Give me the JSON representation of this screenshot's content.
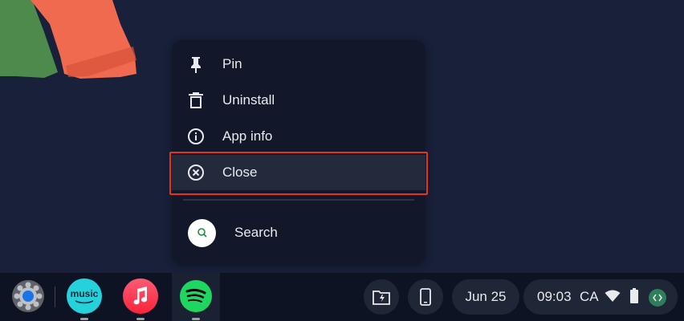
{
  "context_menu": {
    "items": [
      {
        "label": "Pin",
        "icon": "pin-icon"
      },
      {
        "label": "Uninstall",
        "icon": "trash-icon"
      },
      {
        "label": "App info",
        "icon": "info-icon"
      },
      {
        "label": "Close",
        "icon": "close-circle-icon",
        "highlighted": true
      }
    ],
    "search": {
      "label": "Search",
      "icon": "search-icon"
    }
  },
  "shelf": {
    "apps": [
      {
        "name": "launcher",
        "icon": "launcher-icon"
      },
      {
        "name": "Amazon Music",
        "icon": "amazon-music-icon",
        "text": "music"
      },
      {
        "name": "Apple Music",
        "icon": "apple-music-icon"
      },
      {
        "name": "Spotify",
        "icon": "spotify-icon",
        "active": true
      }
    ],
    "date": "Jun 25",
    "time": "09:03",
    "input_method": "CA",
    "icons": [
      "files-icon",
      "phone-hub-icon",
      "wifi-icon",
      "battery-icon",
      "developer-icon"
    ]
  },
  "colors": {
    "background": "#18203a",
    "highlight_border": "#e8331c",
    "spotify": "#1ed760"
  }
}
